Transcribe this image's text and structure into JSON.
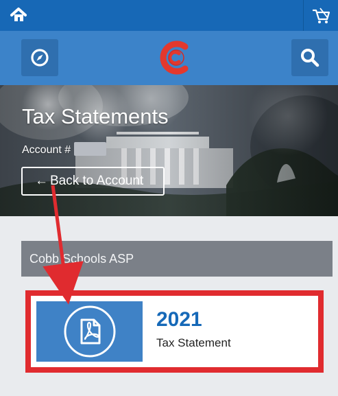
{
  "topbar": {
    "home_icon": "home-icon",
    "cart_icon": "cart-icon"
  },
  "navbar": {
    "left_icon": "compass-icon",
    "logo_text": "C",
    "search_icon": "search-icon"
  },
  "hero": {
    "title": "Tax Statements",
    "account_label": "Account #",
    "back_label": "Back to Account"
  },
  "panel": {
    "title": "Cobb Schools ASP",
    "statements": [
      {
        "year": "2021",
        "label": "Tax Statement",
        "icon": "pdf-icon"
      }
    ]
  },
  "colors": {
    "top_blue": "#1768b6",
    "nav_blue": "#3c83c9",
    "panel_gray": "#7b8088",
    "highlight_red": "#e02b2f",
    "year_blue": "#1669b8",
    "logo_red": "#e3382d"
  }
}
